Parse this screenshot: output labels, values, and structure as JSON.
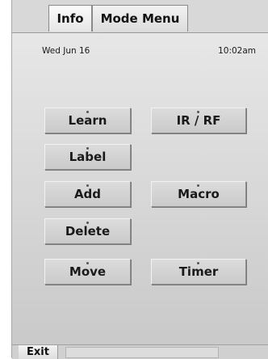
{
  "tabs": [
    {
      "label": "Info"
    },
    {
      "label": "Mode Menu"
    }
  ],
  "header": {
    "date": "Wed Jun 16",
    "time": "10:02am"
  },
  "buttons": {
    "learn": "Learn",
    "ir_rf": "IR / RF",
    "label": "Label",
    "add": "Add",
    "macro": "Macro",
    "delete": "Delete",
    "move": "Move",
    "timer": "Timer"
  },
  "footer": {
    "exit_label": "Exit"
  }
}
